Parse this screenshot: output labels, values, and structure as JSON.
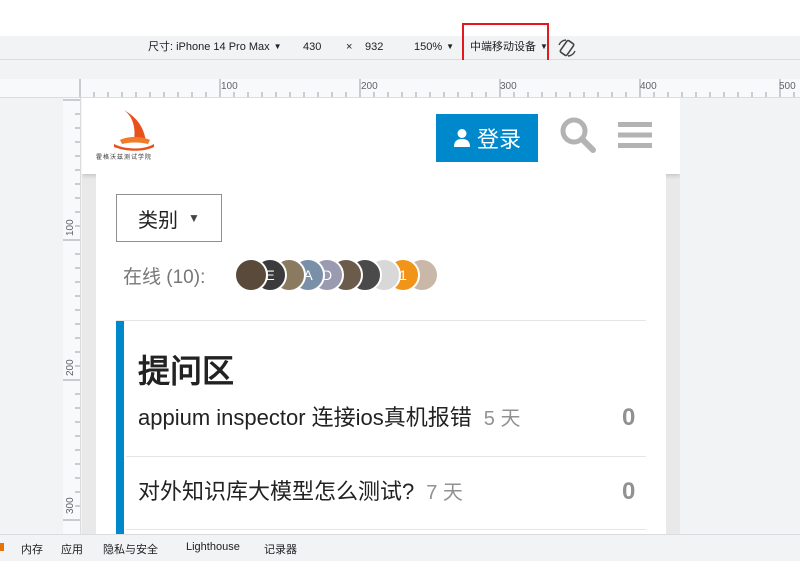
{
  "devtools": {
    "device_label": "尺寸: iPhone 14 Pro Max",
    "width": "430",
    "times": "×",
    "height": "932",
    "zoom": "150%",
    "throttle": "中端移动设备"
  },
  "ruler": {
    "top_ticks": [
      "100",
      "200",
      "300",
      "400",
      "500"
    ],
    "side_ticks": [
      "100",
      "200",
      "300"
    ]
  },
  "site": {
    "logo_text": "霍格沃兹测试学院",
    "login_label": "登录",
    "category_button": "类别",
    "online_label": "在线 (10):",
    "avatars": [
      {
        "letter": "",
        "color": "#5a4a3a"
      },
      {
        "letter": "E",
        "color": "#3b3b3b"
      },
      {
        "letter": "",
        "color": "#8a7a60"
      },
      {
        "letter": "A",
        "color": "#7a8fa8"
      },
      {
        "letter": "D",
        "color": "#9a9ab0"
      },
      {
        "letter": "",
        "color": "#6b5b4b"
      },
      {
        "letter": "",
        "color": "#4a4a4a"
      },
      {
        "letter": "",
        "color": "#d8d8d8"
      },
      {
        "letter": "1",
        "color": "#f0951a"
      },
      {
        "letter": "",
        "color": "#c9b8a8"
      }
    ],
    "category_title": "提问区",
    "topics": [
      {
        "title": "appium inspector 连接ios真机报错",
        "age": "5 天",
        "count": "0"
      },
      {
        "title": "对外知识库大模型怎么测试?",
        "age": "7 天",
        "count": "0"
      }
    ]
  },
  "drawer": {
    "tabs": [
      "内存",
      "应用",
      "隐私与安全",
      "Lighthouse",
      "记录器"
    ]
  },
  "colors": {
    "brand": "#0088cc",
    "highlight": "#e4181f"
  }
}
